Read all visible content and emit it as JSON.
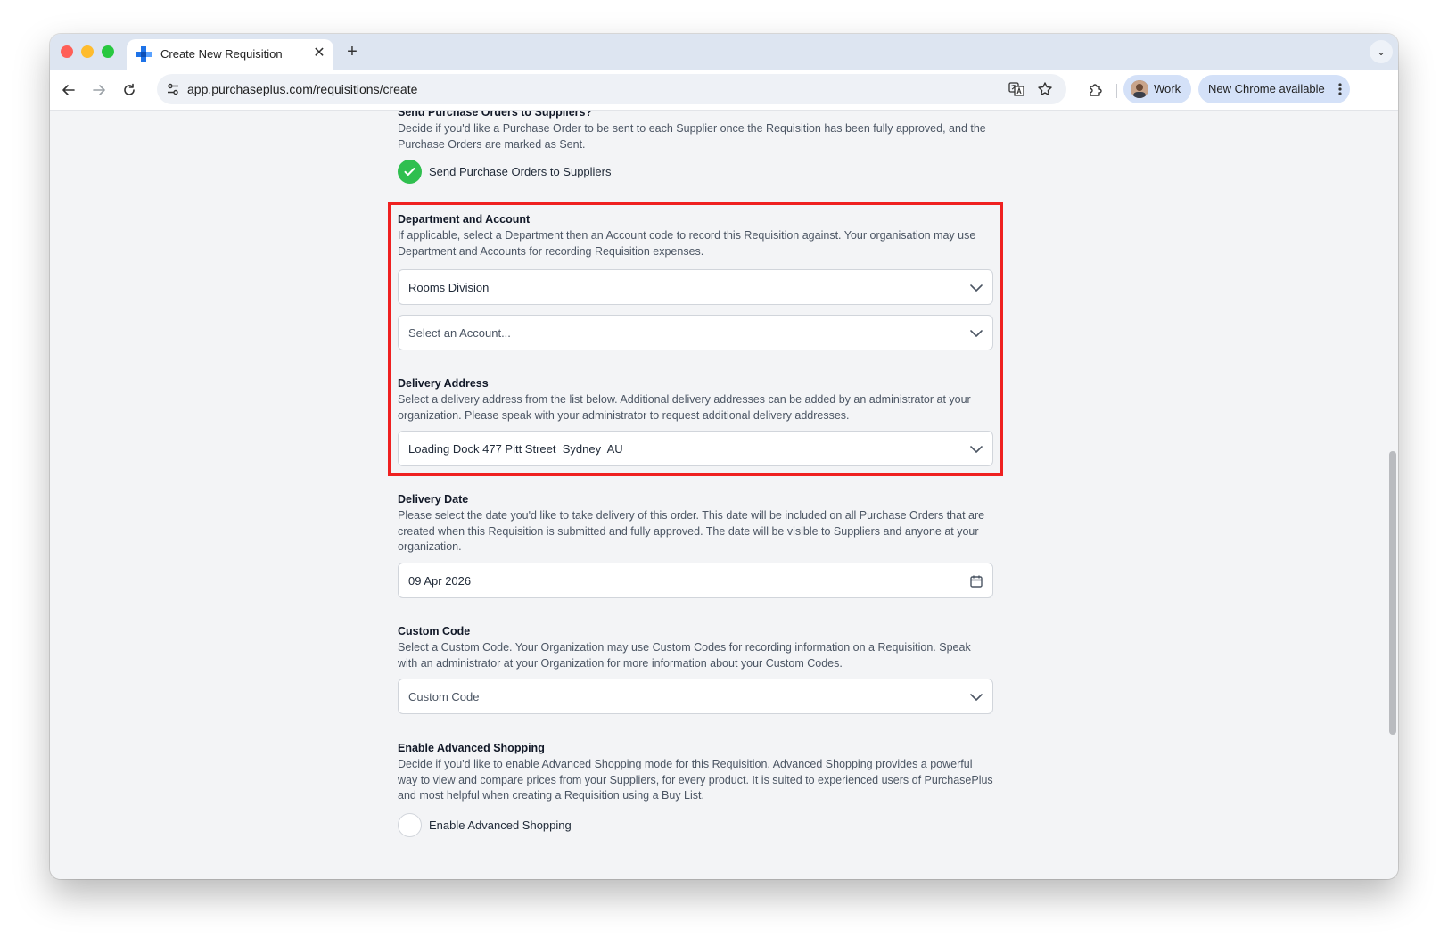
{
  "browser": {
    "tab_title": "Create New Requisition",
    "tab_close": "✕",
    "new_tab": "+",
    "tab_menu": "⌄",
    "url": "app.purchaseplus.com/requisitions/create",
    "profile_label": "Work",
    "update_label": "New Chrome available"
  },
  "icons": {
    "back": "arrow-left-icon",
    "forward": "arrow-right-icon",
    "reload": "reload-icon",
    "site_info": "tune-icon",
    "translate": "translate-icon",
    "bookmark": "star-icon",
    "extensions": "puzzle-icon",
    "menu": "kebab-icon",
    "chevron": "chevron-down-icon",
    "calendar": "calendar-icon",
    "check": "check-circle-icon"
  },
  "colors": {
    "accent_green": "#2fbf4f",
    "highlight_red": "#ef2020",
    "favicon_blue": "#1e73e8"
  },
  "form": {
    "send_po": {
      "title": "Send Purchase Orders to Suppliers?",
      "description": "Decide if you'd like a Purchase Order to be sent to each Supplier once the Requisition has been fully approved, and the Purchase Orders are marked as Sent.",
      "checkbox_label": "Send Purchase Orders to Suppliers",
      "checked": true
    },
    "department_account": {
      "title": "Department and Account",
      "description": "If applicable, select a Department then an Account code to record this Requisition against. Your organisation may use Department and Accounts for recording Requisition expenses.",
      "department_value": "Rooms Division",
      "account_placeholder": "Select an Account..."
    },
    "delivery_address": {
      "title": "Delivery Address",
      "description": "Select a delivery address from the list below. Additional delivery addresses can be added by an administrator at your organization. Please speak with your administrator to request additional delivery addresses.",
      "value": "Loading Dock 477 Pitt Street  Sydney  AU"
    },
    "delivery_date": {
      "title": "Delivery Date",
      "description": "Please select the date you'd like to take delivery of this order. This date will be included on all Purchase Orders that are created when this Requisition is submitted and fully approved. The date will be visible to Suppliers and anyone at your organization.",
      "value": "09 Apr 2026"
    },
    "custom_code": {
      "title": "Custom Code",
      "description": "Select a Custom Code. Your Organization may use Custom Codes for recording information on a Requisition. Speak with an administrator at your Organization for more information about your Custom Codes.",
      "placeholder": "Custom Code"
    },
    "advanced_shopping": {
      "title": "Enable Advanced Shopping",
      "description": "Decide if you'd like to enable Advanced Shopping mode for this Requisition. Advanced Shopping provides a powerful way to view and compare prices from your Suppliers, for every product. It is suited to experienced users of PurchasePlus and most helpful when creating a Requisition using a Buy List.",
      "checkbox_label": "Enable Advanced Shopping",
      "checked": false
    }
  }
}
